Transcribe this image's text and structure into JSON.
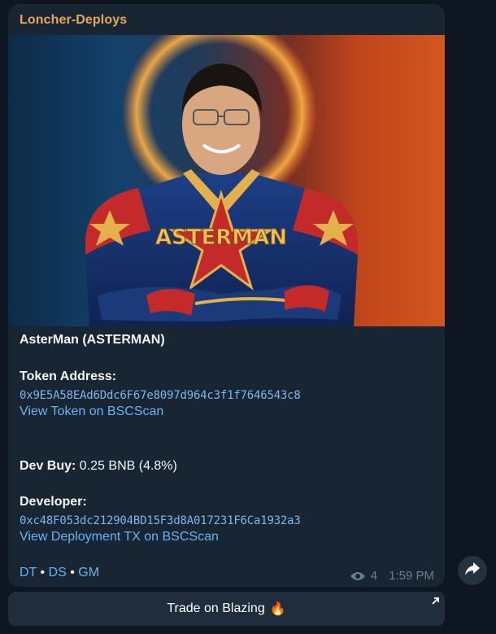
{
  "message": {
    "sender": "Loncher-Deploys",
    "image_alt": "ASTERMAN",
    "title": "AsterMan (ASTERMAN)",
    "token_address_label": "Token Address:",
    "token_address": "0x9E5A58EAd6Ddc6F67e8097d964c3f1f7646543c8",
    "view_token_link": "View Token on BSCScan",
    "dev_buy_label": "Dev Buy:",
    "dev_buy_value": " 0.25 BNB (4.8%)",
    "developer_label": "Developer:",
    "developer_address": "0xc48F053dc212904BD15F3d8A017231F6Ca1932a3",
    "view_deployment_link": "View Deployment TX on BSCScan",
    "links": {
      "dt": "DT",
      "ds": "DS",
      "gm": "GM",
      "separator": " • "
    },
    "views": "4",
    "time": "1:59 PM"
  },
  "inline_button": {
    "label": "Trade on Blazing",
    "emoji": "🔥"
  },
  "icons": {
    "eye": "eye-icon",
    "forward": "forward-arrow-icon",
    "external": "external-link-arrow-icon"
  },
  "colors": {
    "background": "#0e1621",
    "bubble": "#182533",
    "sender": "#e7a55a",
    "link": "#6ab3f3",
    "mono": "#7cb6ec"
  }
}
